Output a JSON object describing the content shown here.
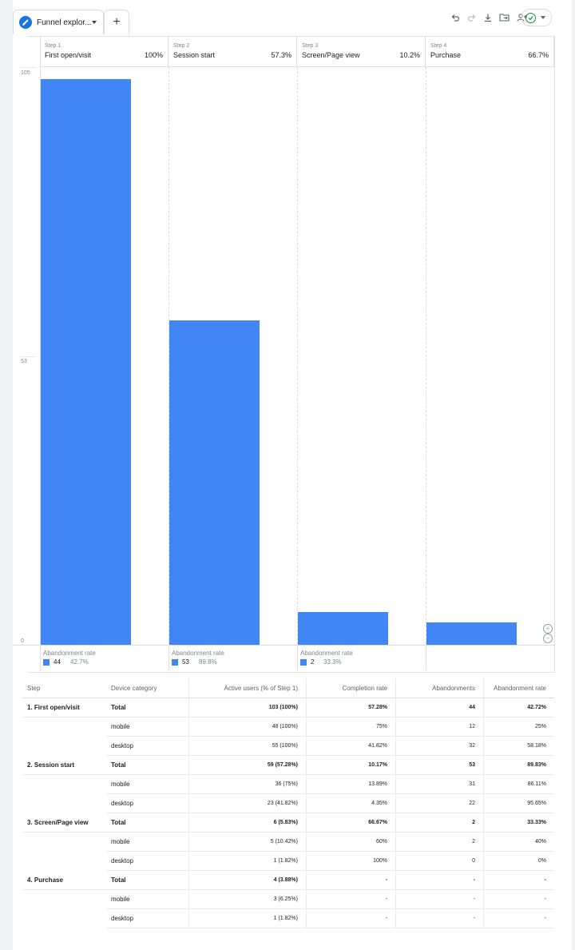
{
  "tab": {
    "label": "Funnel explor...",
    "add_label": "+"
  },
  "toolbar": {
    "icons": [
      "undo-icon",
      "redo-icon",
      "download-icon",
      "move-folder-icon",
      "share-user-icon",
      "status-check-icon"
    ]
  },
  "chart_data": {
    "type": "bar",
    "categories": [
      "First open/visit",
      "Session start",
      "Screen/Page view",
      "Purchase"
    ],
    "values": [
      103,
      59,
      6,
      4
    ],
    "ylim": [
      0,
      105
    ],
    "y_ticks": [
      "105",
      "53",
      "0"
    ],
    "color": "#4285f4",
    "steps": [
      {
        "step": "Step 1",
        "name": "First open/visit",
        "pct": "100%",
        "abandon_label": "Abandonment rate",
        "abandon_count": "44",
        "abandon_rate": "42.7%"
      },
      {
        "step": "Step 2",
        "name": "Session start",
        "pct": "57.3%",
        "abandon_label": "Abandonment rate",
        "abandon_count": "53",
        "abandon_rate": "89.8%"
      },
      {
        "step": "Step 3",
        "name": "Screen/Page view",
        "pct": "10.2%",
        "abandon_label": "Abandonment rate",
        "abandon_count": "2",
        "abandon_rate": "33.3%"
      },
      {
        "step": "Step 4",
        "name": "Purchase",
        "pct": "66.7%",
        "abandon_label": "",
        "abandon_count": "",
        "abandon_rate": ""
      }
    ]
  },
  "table": {
    "headers": [
      "Step",
      "Device category",
      "Active users (% of Step 1)",
      "Completion rate",
      "Abandonments",
      "Abandonment rate"
    ],
    "rows": [
      [
        "1. First open/visit",
        "Total",
        "103 (100%)",
        "57.28%",
        "44",
        "42.72%"
      ],
      [
        "",
        "mobile",
        "48 (100%)",
        "75%",
        "12",
        "25%"
      ],
      [
        "",
        "desktop",
        "55 (100%)",
        "41.82%",
        "32",
        "58.18%"
      ],
      [
        "2. Session start",
        "Total",
        "59 (57.28%)",
        "10.17%",
        "53",
        "89.83%"
      ],
      [
        "",
        "mobile",
        "36 (75%)",
        "13.89%",
        "31",
        "86.11%"
      ],
      [
        "",
        "desktop",
        "23 (41.82%)",
        "4.35%",
        "22",
        "95.65%"
      ],
      [
        "3. Screen/Page view",
        "Total",
        "6 (5.83%)",
        "66.67%",
        "2",
        "33.33%"
      ],
      [
        "",
        "mobile",
        "5 (10.42%)",
        "60%",
        "2",
        "40%"
      ],
      [
        "",
        "desktop",
        "1 (1.82%)",
        "100%",
        "0",
        "0%"
      ],
      [
        "4. Purchase",
        "Total",
        "4 (3.88%)",
        "-",
        "-",
        "-"
      ],
      [
        "",
        "mobile",
        "3 (6.25%)",
        "-",
        "-",
        "-"
      ],
      [
        "",
        "desktop",
        "1 (1.82%)",
        "-",
        "-",
        "-"
      ]
    ]
  }
}
